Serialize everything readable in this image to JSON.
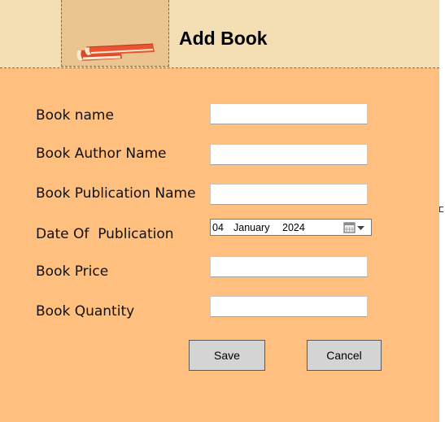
{
  "header": {
    "title": "Add Book",
    "logo_icon": "books-icon"
  },
  "form": {
    "fields": [
      {
        "label": "Book name",
        "value": ""
      },
      {
        "label": "Book Author Name",
        "value": ""
      },
      {
        "label": "Book Publication Name",
        "value": ""
      },
      {
        "label": "Date Of  Publication"
      },
      {
        "label": "Book Price",
        "value": ""
      },
      {
        "label": "Book Quantity",
        "value": ""
      }
    ],
    "date": {
      "day": "04",
      "month": "January",
      "year": "2024",
      "icon": "calendar-dropdown-icon"
    }
  },
  "buttons": {
    "save_label": "Save",
    "cancel_label": "Cancel"
  },
  "colors": {
    "background": "#ffbf7f",
    "header": "#f4deb3",
    "logo_panel": "#ebc48f",
    "button": "#d4d4d4"
  }
}
